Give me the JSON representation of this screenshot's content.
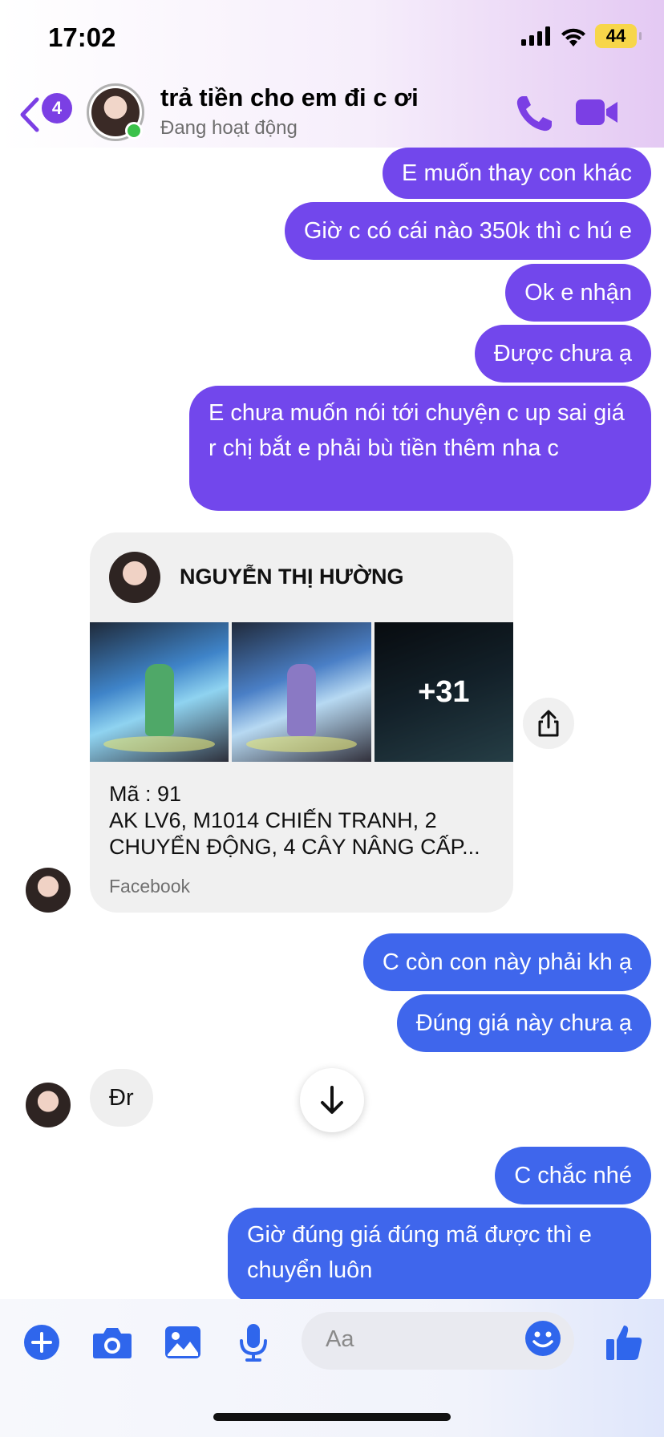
{
  "status_bar": {
    "time": "17:02",
    "battery": "44"
  },
  "header": {
    "back_badge": "4",
    "name": "trả tiền cho em đi c ơi",
    "status": "Đang hoạt động"
  },
  "messages": [
    {
      "text": "E muốn thay con khác"
    },
    {
      "text": "Giờ c có cái nào 350k thì c hú e"
    },
    {
      "text": "Ok e nhận"
    },
    {
      "text": "Được chưa ạ"
    },
    {
      "text": "E chưa muốn nói tới chuyện c up sai giá r chị bắt e phải bù tiền thêm nha c"
    },
    {
      "text": "C còn con này phải kh ạ"
    },
    {
      "text": "Đúng giá này chưa ạ"
    },
    {
      "text": "Đr"
    },
    {
      "text": "C chắc nhé"
    },
    {
      "text": "Giờ đúng giá đúng mã được thì e chuyển luôn"
    }
  ],
  "shared_post": {
    "author": "NGUYỄN THỊ HƯỜNG",
    "more_photos": "+31",
    "code_line": "Mã : 91",
    "description": "AK LV6, M1014 CHIẾN TRANH, 2 CHUYỂN ĐỘNG, 4 CÂY NÂNG CẤP...",
    "source": "Facebook"
  },
  "composer": {
    "placeholder": "Aa"
  },
  "colors": {
    "accent": "#7247ec",
    "blue_bubble": "#3f66ec",
    "incoming_bubble": "#efefef"
  }
}
